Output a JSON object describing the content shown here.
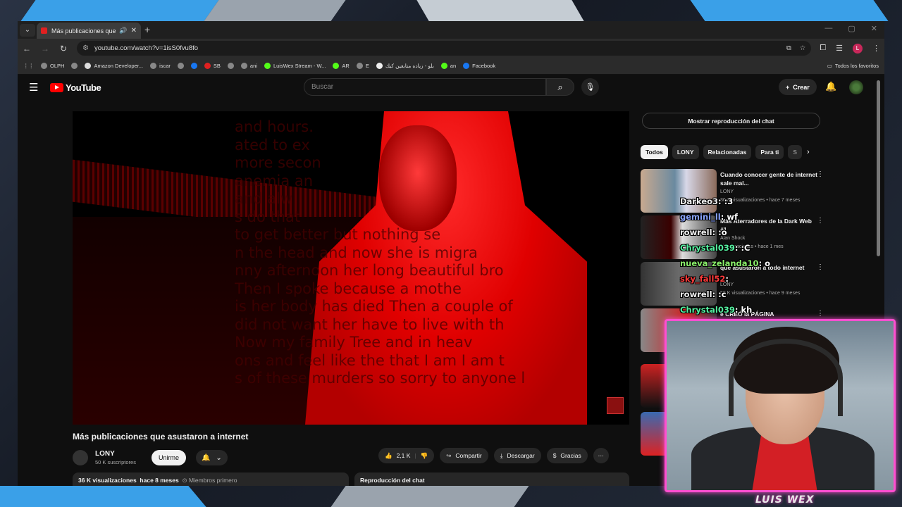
{
  "browser": {
    "tab_title": "Más publicaciones que asustaron",
    "url": "youtube.com/watch?v=1isS0fvu8fo",
    "bookmarks": [
      "OLPH",
      "",
      "Amazon Developer...",
      "iscar",
      "",
      "",
      "SB",
      "",
      "ani",
      "LuisWex Stream - W...",
      "AR",
      "E",
      "بلو - زياده متابعين كيك",
      "an",
      "Facebook"
    ],
    "all_bookmarks_label": "Todos los favoritos"
  },
  "youtube": {
    "logo_text": "YouTube",
    "search_placeholder": "Buscar",
    "create_label": "Crear",
    "video": {
      "overlay_lines": [
        "   and hours.",
        "      ated to ex",
        "       more secon",
        "     anemia an",
        "        and alw",
        "           s do that",
        "  to get better but nothing se",
        "   n the head and now she is migra",
        "  nny afternoon her long beautiful bro",
        "  Then I spoke because a mothe",
        "   is her body has died Then a couple of",
        "   did not want her have to live with th",
        "  Now my family Tree and in heav",
        "  ons and feel like the that I am I am t",
        "  s of these murders so sorry to anyone l"
      ],
      "title": "Más publicaciones que asustaron a internet",
      "channel": "LONY",
      "subscribers": "50 K suscriptores",
      "join_label": "Unirme",
      "likes": "2,1 K",
      "share_label": "Compartir",
      "download_label": "Descargar",
      "thanks_label": "Gracias",
      "views": "36 K visualizaciones",
      "date": "hace 8 meses",
      "members_label": "Miembros primero",
      "chat_replay_label": "Reproducción del chat"
    },
    "show_chat_label": "Mostrar reproducción del chat",
    "chips": [
      "Todos",
      "LONY",
      "Relacionadas",
      "Para ti",
      "S"
    ],
    "recommendations": [
      {
        "title": "Cuando conocer gente de internet sale mal...",
        "channel": "LONY",
        "meta": "36 K visualizaciones • hace 7 meses"
      },
      {
        "title": "Más Aterradores de la Dark Web #1",
        "channel": "Alan Shock",
        "meta": "visualizaciones • hace 1 mes"
      },
      {
        "title": "que asustaron a todo internet",
        "channel": "LONY",
        "meta": "58 K visualizaciones • hace 9 meses"
      },
      {
        "title": "e CREÓ la PÁGINA",
        "channel": "",
        "meta": ""
      }
    ]
  },
  "stream_chat": [
    {
      "user": "Darkeo3",
      "msg": ": :3",
      "color": "#ffffff"
    },
    {
      "user": "gemini_ll",
      "msg": ": wf",
      "color": "#8aa4ff"
    },
    {
      "user": "rowrell",
      "msg": ": :o",
      "color": "#ffffff"
    },
    {
      "user": "Chrystal039",
      "msg": ": :C",
      "color": "#55f0a0"
    },
    {
      "user": "nueva_zelanda10",
      "msg": ": o",
      "color": "#8af06a"
    },
    {
      "user": "sky_fall52",
      "msg": ":",
      "color": "#ff3b3b"
    },
    {
      "user": "rowrell",
      "msg": ": :c",
      "color": "#ffffff"
    },
    {
      "user": "Chrystal039",
      "msg": ": kh",
      "color": "#55f0a0"
    }
  ],
  "streamer_name": "LUIS WEX"
}
